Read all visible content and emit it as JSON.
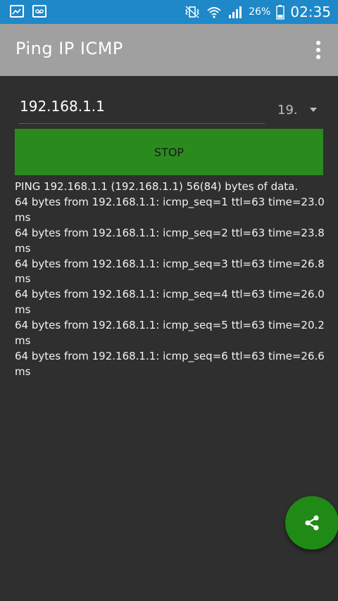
{
  "status_bar": {
    "battery": "26%",
    "time": "02:35"
  },
  "toolbar": {
    "title": "Ping IP ICMP",
    "menu_icon": "overflow-menu-icon"
  },
  "form": {
    "ip_value": "192.168.1.1",
    "count_value": "19."
  },
  "actions": {
    "stop_label": "STOP",
    "share_icon": "share-icon"
  },
  "output": {
    "lines": [
      "PING 192.168.1.1 (192.168.1.1) 56(84) bytes of data.",
      "64 bytes from 192.168.1.1: icmp_seq=1 ttl=63 time=23.0 ms",
      "64 bytes from 192.168.1.1: icmp_seq=2 ttl=63 time=23.8 ms",
      "64 bytes from 192.168.1.1: icmp_seq=3 ttl=63 time=26.8 ms",
      "64 bytes from 192.168.1.1: icmp_seq=4 ttl=63 time=26.0 ms",
      "64 bytes from 192.168.1.1: icmp_seq=5 ttl=63 time=20.2 ms",
      "64 bytes from 192.168.1.1: icmp_seq=6 ttl=63 time=26.6 ms"
    ]
  },
  "colors": {
    "status_bar": "#1e88c8",
    "toolbar": "#a0a0a0",
    "background": "#2f2f2f",
    "accent_green": "#2a8a1e"
  }
}
